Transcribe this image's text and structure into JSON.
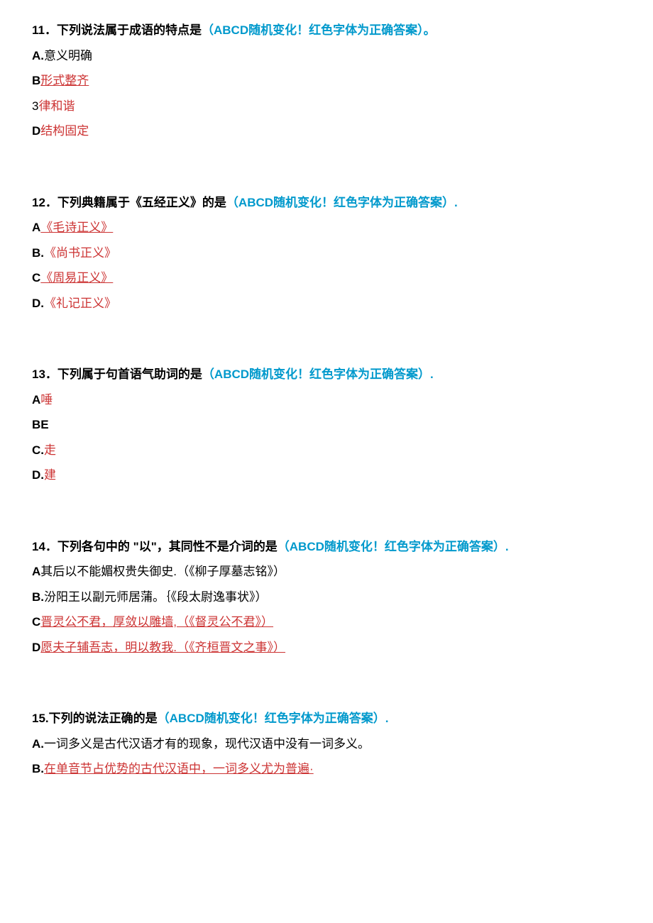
{
  "questions": [
    {
      "number": "11",
      "stem": "．下列说法属于成语的特点是",
      "hint": "（ABCD随机变化！红色字体为正确答案）。",
      "options": [
        {
          "label": "A.",
          "label_bold": true,
          "text": "意义明确",
          "red": false,
          "underline": false
        },
        {
          "label": "B",
          "label_bold": true,
          "text": "形式整齐",
          "red": true,
          "underline": true
        },
        {
          "label": "3",
          "label_bold": false,
          "text": "律和谐",
          "red": true,
          "underline": false
        },
        {
          "label": "D",
          "label_bold": true,
          "text": "结构固定",
          "red": true,
          "underline": false
        }
      ]
    },
    {
      "number": "12",
      "stem": "．下列典籍属于《五经正义》的是",
      "hint": "（ABCD随机变化！红色字体为正确答案）.",
      "options": [
        {
          "label": "A",
          "label_bold": true,
          "text": "《毛诗正义》",
          "red": true,
          "underline": true
        },
        {
          "label": "B.",
          "label_bold": true,
          "text": "《尚书正义》",
          "red": true,
          "underline": false
        },
        {
          "label": "C",
          "label_bold": true,
          "text": "《周易正义》",
          "red": true,
          "underline": true
        },
        {
          "label": "D.",
          "label_bold": true,
          "text": "《礼记正义》",
          "red": true,
          "underline": false
        }
      ]
    },
    {
      "number": "13",
      "stem": "．下列属于句首语气助词的是",
      "hint": "（ABCD随机变化！红色字体为正确答案）.",
      "options": [
        {
          "label": "A",
          "label_bold": true,
          "text": "唾",
          "red": true,
          "underline": false
        },
        {
          "label": "BE",
          "label_bold": true,
          "text": "",
          "red": false,
          "underline": false
        },
        {
          "label": "C.",
          "label_bold": true,
          "text": "走",
          "red": true,
          "underline": false
        },
        {
          "label": "D.",
          "label_bold": true,
          "text": "建",
          "red": true,
          "underline": false
        }
      ]
    },
    {
      "number": "14",
      "stem": "．下列各句中的 \"以\"，其同性不是介词的是",
      "hint": "（ABCD随机变化！红色字体为正确答案）.",
      "options": [
        {
          "label": "A",
          "label_bold": true,
          "text": "其后以不能媚权贵失御史.（《柳子厚墓志铭》）",
          "red": false,
          "underline": false
        },
        {
          "label": "B.",
          "label_bold": true,
          "text": "汾阳王以副元师居蒲。｛《段太尉逸事状》）",
          "red": false,
          "underline": false
        },
        {
          "label": "C",
          "label_bold": true,
          "text": "晋灵公不君，厚敛以雕墙,（《督灵公不君》）",
          "red": true,
          "underline": true
        },
        {
          "label": "D",
          "label_bold": true,
          "text": "愿夫子辅吾志，明以教我.（《齐桓晋文之事》）",
          "red": true,
          "underline": true
        }
      ]
    },
    {
      "number": "15.",
      "stem": "下列的说法正确的是",
      "hint": "（ABCD随机变化！红色字体为正确答案）.",
      "options": [
        {
          "label": "A.",
          "label_bold": true,
          "text": "一词多义是古代汉语才有的现象，现代汉语中没有一词多义。",
          "red": false,
          "underline": false
        },
        {
          "label": "B.",
          "label_bold": true,
          "text": "在单音节占优势的古代汉语中，一词多义尤为普遍·",
          "red": true,
          "underline": true
        }
      ]
    }
  ]
}
